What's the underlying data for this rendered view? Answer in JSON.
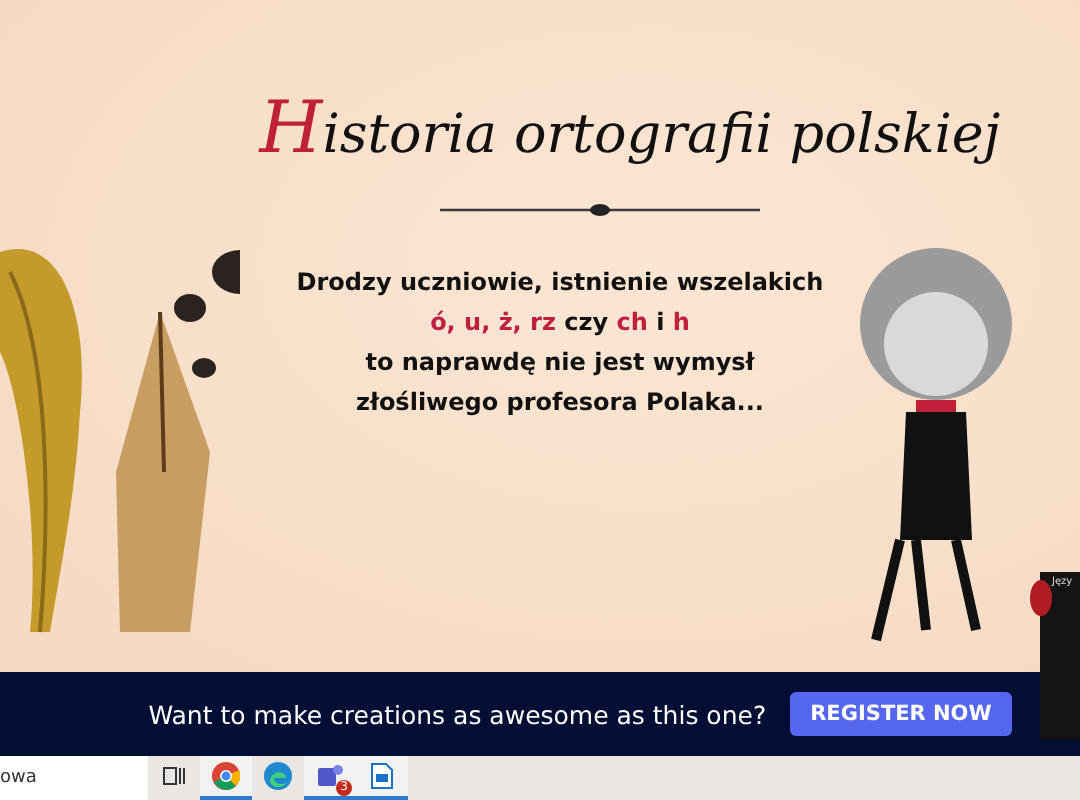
{
  "title": [
    {
      "text": "H",
      "kind": "accent"
    },
    {
      "text": "istoria ortografii polskiej",
      "kind": "plain"
    }
  ],
  "message": [
    [
      {
        "text": "Drodzy uczniowie, istnienie wszelakich",
        "kind": "plain"
      }
    ],
    [
      {
        "text": "ó, u, ż, rz",
        "kind": "accent"
      },
      {
        "text": " czy ",
        "kind": "plain"
      },
      {
        "text": "ch",
        "kind": "accent"
      },
      {
        "text": " i ",
        "kind": "plain"
      },
      {
        "text": "h",
        "kind": "accent"
      }
    ],
    [
      {
        "text": "to naprawdę nie jest wymysł",
        "kind": "plain"
      }
    ],
    [
      {
        "text": "złośliwego profesora Polaka...",
        "kind": "plain"
      }
    ]
  ],
  "side_panel": {
    "label": "Języ"
  },
  "banner": {
    "text": "Want to make creations as awesome as this one?",
    "button": "REGISTER NOW"
  },
  "taskbar": {
    "search": "owa",
    "apps": [
      {
        "kind": "taskview",
        "active": false
      },
      {
        "kind": "chrome",
        "active": true
      },
      {
        "kind": "edge",
        "active": false
      },
      {
        "kind": "teams",
        "active": true,
        "badge": "3"
      },
      {
        "kind": "doc",
        "active": true
      }
    ]
  }
}
